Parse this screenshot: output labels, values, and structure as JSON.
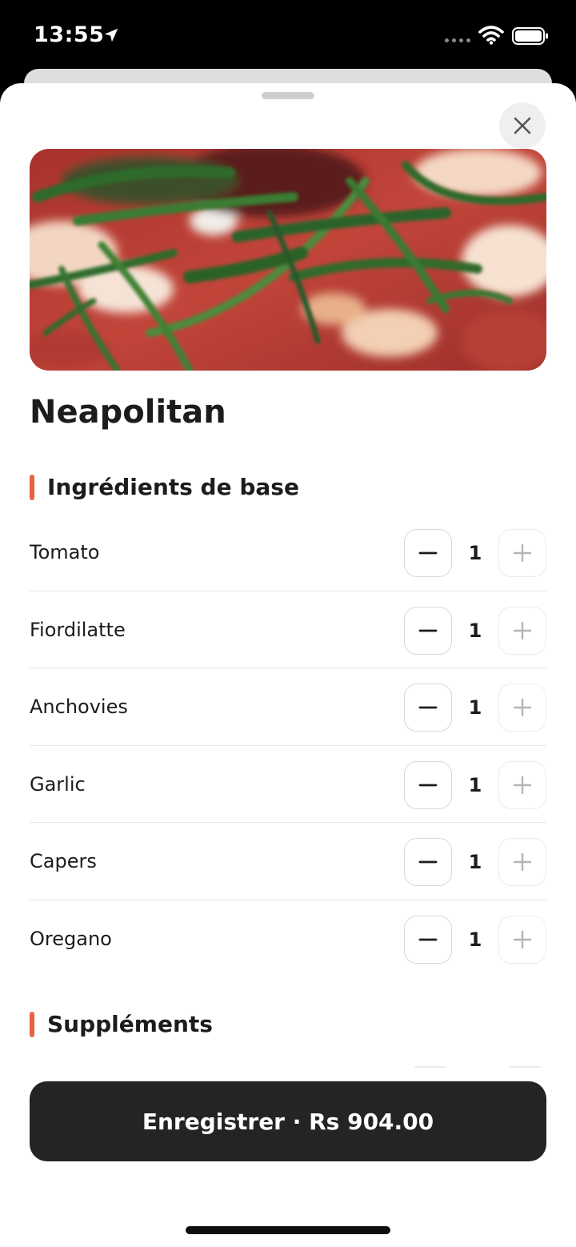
{
  "status_bar": {
    "time": "13:55",
    "icons": [
      "location-arrow-icon",
      "signal-dots-icon",
      "wifi-icon",
      "battery-icon"
    ]
  },
  "product": {
    "name": "Neapolitan",
    "image": "pizza-photo"
  },
  "sections": {
    "base_title": "Ingrédients de base",
    "supplements_title": "Suppléments"
  },
  "ingredients": [
    {
      "name": "Tomato",
      "qty": "1"
    },
    {
      "name": "Fiordilatte",
      "qty": "1"
    },
    {
      "name": "Anchovies",
      "qty": "1"
    },
    {
      "name": "Garlic",
      "qty": "1"
    },
    {
      "name": "Capers",
      "qty": "1"
    },
    {
      "name": "Oregano",
      "qty": "1"
    }
  ],
  "save_button": {
    "label": "Enregistrer · Rs 904.00"
  },
  "colors": {
    "accent": "#e8623e",
    "button": "#242424",
    "text": "#1c1c1c"
  }
}
